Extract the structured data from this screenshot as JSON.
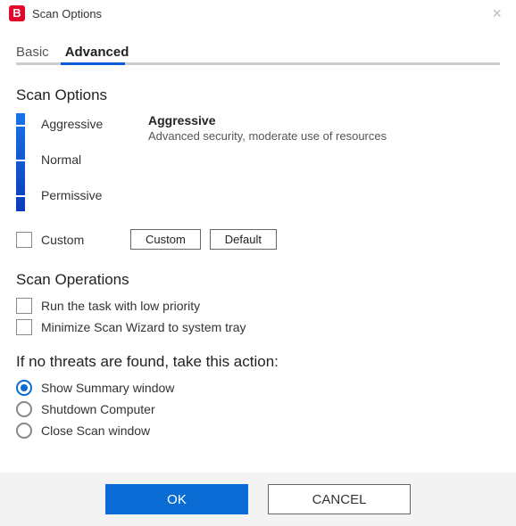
{
  "window": {
    "app_glyph": "B",
    "title": "Scan Options"
  },
  "tabs": {
    "basic": "Basic",
    "advanced": "Advanced",
    "active": "advanced"
  },
  "scan_options": {
    "title": "Scan Options",
    "levels": {
      "aggressive": "Aggressive",
      "normal": "Normal",
      "permissive": "Permissive"
    },
    "selected_level_name": "Aggressive",
    "selected_level_desc": "Advanced security, moderate use of resources",
    "custom_label": "Custom",
    "custom_button": "Custom",
    "default_button": "Default"
  },
  "scan_operations": {
    "title": "Scan Operations",
    "low_priority": "Run the task with low priority",
    "minimize_tray": "Minimize Scan Wizard to system tray"
  },
  "no_threats": {
    "title": "If no threats are found, take this action:",
    "show_summary": "Show Summary window",
    "shutdown": "Shutdown Computer",
    "close_window": "Close Scan window",
    "selected": "show_summary"
  },
  "footer": {
    "ok": "OK",
    "cancel": "CANCEL"
  }
}
